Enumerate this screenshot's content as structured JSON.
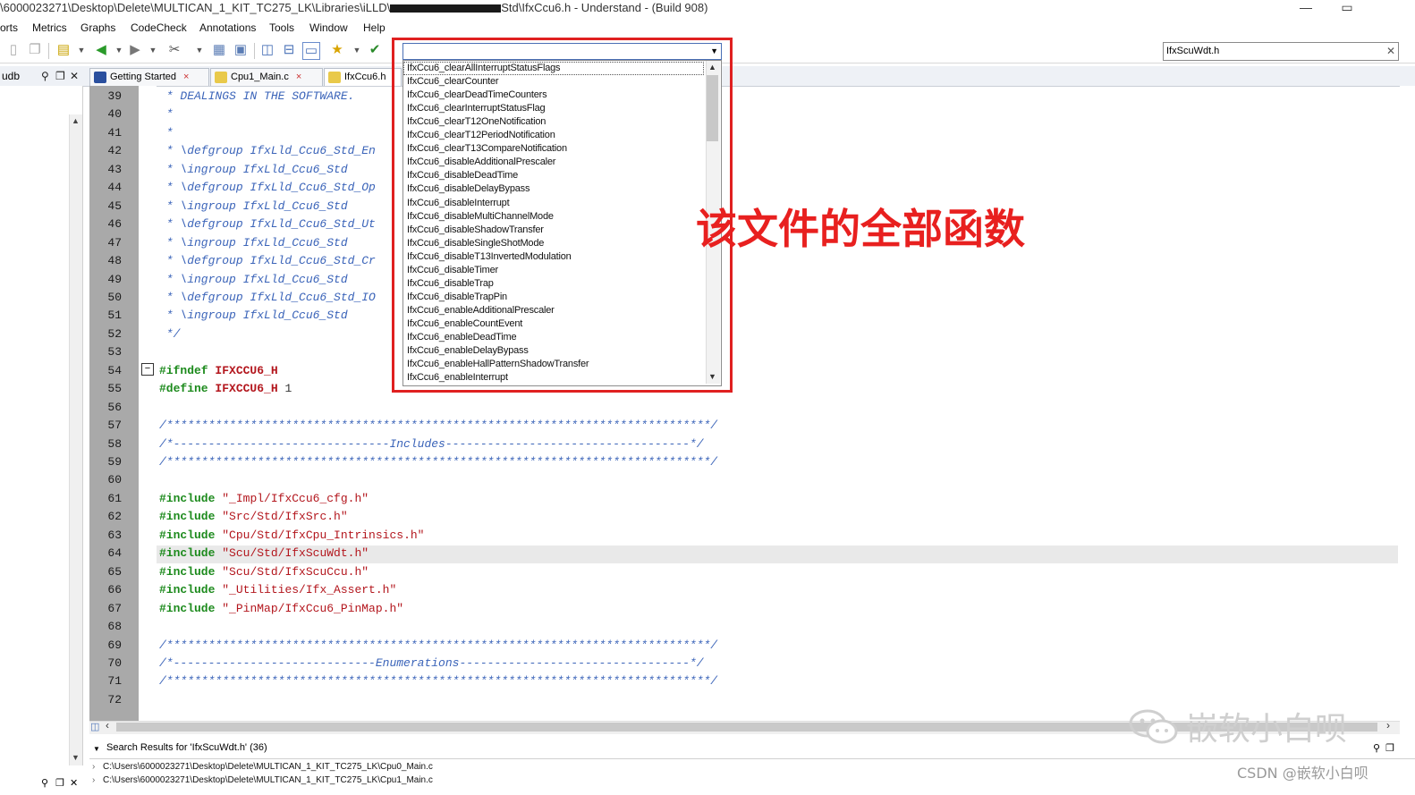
{
  "window": {
    "title_left": "\\6000023271\\Desktop\\Delete\\MULTICAN_1_KIT_TC275_LK\\Libraries\\iLLD\\",
    "title_right": "Std\\IfxCcu6.h - Understand - (Build 908)",
    "minimize": "—",
    "maximize": "▭"
  },
  "menu": [
    "orts",
    "Metrics",
    "Graphs",
    "CodeCheck",
    "Annotations",
    "Tools",
    "Window",
    "Help"
  ],
  "toolbar": {
    "function_combo_value": "",
    "search_value": "IfxScuWdt.h",
    "search_clear": "✕"
  },
  "left_pane": {
    "title": "udb"
  },
  "tabs": [
    {
      "label": "Getting Started",
      "close": "×"
    },
    {
      "label": "Cpu1_Main.c",
      "close": "×"
    },
    {
      "label": "IfxCcu6.h",
      "close": ""
    }
  ],
  "code_lines": [
    {
      "num": "39",
      "text": " * DEALINGS IN THE SOFTWARE."
    },
    {
      "num": "40",
      "text": " *"
    },
    {
      "num": "41",
      "text": " *"
    },
    {
      "num": "42",
      "text": " * \\defgroup IfxLld_Ccu6_Std_En"
    },
    {
      "num": "43",
      "text": " * \\ingroup IfxLld_Ccu6_Std"
    },
    {
      "num": "44",
      "text": " * \\defgroup IfxLld_Ccu6_Std_Op"
    },
    {
      "num": "45",
      "text": " * \\ingroup IfxLld_Ccu6_Std"
    },
    {
      "num": "46",
      "text": " * \\defgroup IfxLld_Ccu6_Std_Ut"
    },
    {
      "num": "47",
      "text": " * \\ingroup IfxLld_Ccu6_Std"
    },
    {
      "num": "48",
      "text": " * \\defgroup IfxLld_Ccu6_Std_Cr"
    },
    {
      "num": "49",
      "text": " * \\ingroup IfxLld_Ccu6_Std"
    },
    {
      "num": "50",
      "text": " * \\defgroup IfxLld_Ccu6_Std_IO"
    },
    {
      "num": "51",
      "text": " * \\ingroup IfxLld_Ccu6_Std"
    },
    {
      "num": "52",
      "text": " */"
    },
    {
      "num": "53",
      "text": ""
    },
    {
      "num": "54",
      "text": "#ifndef IFXCCU6_H"
    },
    {
      "num": "55",
      "text": "#define IFXCCU6_H 1"
    },
    {
      "num": "56",
      "text": ""
    },
    {
      "num": "57",
      "text": "/******************************************************************************/"
    },
    {
      "num": "58",
      "text": "/*-------------------------------Includes-----------------------------------*/"
    },
    {
      "num": "59",
      "text": "/******************************************************************************/"
    },
    {
      "num": "60",
      "text": ""
    },
    {
      "num": "61",
      "text": "#include \"_Impl/IfxCcu6_cfg.h\""
    },
    {
      "num": "62",
      "text": "#include \"Src/Std/IfxSrc.h\""
    },
    {
      "num": "63",
      "text": "#include \"Cpu/Std/IfxCpu_Intrinsics.h\""
    },
    {
      "num": "64",
      "text": "#include \"Scu/Std/IfxScuWdt.h\""
    },
    {
      "num": "65",
      "text": "#include \"Scu/Std/IfxScuCcu.h\""
    },
    {
      "num": "66",
      "text": "#include \"_Utilities/Ifx_Assert.h\""
    },
    {
      "num": "67",
      "text": "#include \"_PinMap/IfxCcu6_PinMap.h\""
    },
    {
      "num": "68",
      "text": ""
    },
    {
      "num": "69",
      "text": "/******************************************************************************/"
    },
    {
      "num": "70",
      "text": "/*-----------------------------Enumerations---------------------------------*/"
    },
    {
      "num": "71",
      "text": "/******************************************************************************/"
    },
    {
      "num": "72",
      "text": ""
    }
  ],
  "function_list": [
    "IfxCcu6_clearAllInterruptStatusFlags",
    "IfxCcu6_clearCounter",
    "IfxCcu6_clearDeadTimeCounters",
    "IfxCcu6_clearInterruptStatusFlag",
    "IfxCcu6_clearT12OneNotification",
    "IfxCcu6_clearT12PeriodNotification",
    "IfxCcu6_clearT13CompareNotification",
    "IfxCcu6_disableAdditionalPrescaler",
    "IfxCcu6_disableDeadTime",
    "IfxCcu6_disableDelayBypass",
    "IfxCcu6_disableInterrupt",
    "IfxCcu6_disableMultiChannelMode",
    "IfxCcu6_disableShadowTransfer",
    "IfxCcu6_disableSingleShotMode",
    "IfxCcu6_disableT13InvertedModulation",
    "IfxCcu6_disableTimer",
    "IfxCcu6_disableTrap",
    "IfxCcu6_disableTrapPin",
    "IfxCcu6_enableAdditionalPrescaler",
    "IfxCcu6_enableCountEvent",
    "IfxCcu6_enableDeadTime",
    "IfxCcu6_enableDelayBypass",
    "IfxCcu6_enableHallPatternShadowTransfer",
    "IfxCcu6_enableInterrupt"
  ],
  "annotation": "该文件的全部函数",
  "search_results": {
    "title": "Search Results for 'IfxScuWdt.h' (36)",
    "items": [
      "C:\\Users\\6000023271\\Desktop\\Delete\\MULTICAN_1_KIT_TC275_LK\\Cpu0_Main.c",
      "C:\\Users\\6000023271\\Desktop\\Delete\\MULTICAN_1_KIT_TC275_LK\\Cpu1_Main.c"
    ]
  },
  "watermark": "嵌软小白呗",
  "csdn_credit": "CSDN @嵌软小白呗",
  "colors": {
    "accent_red": "#e02020",
    "comment_blue": "#3b64b9",
    "preproc_green": "#1c8a1c",
    "string_red": "#b3161d"
  }
}
